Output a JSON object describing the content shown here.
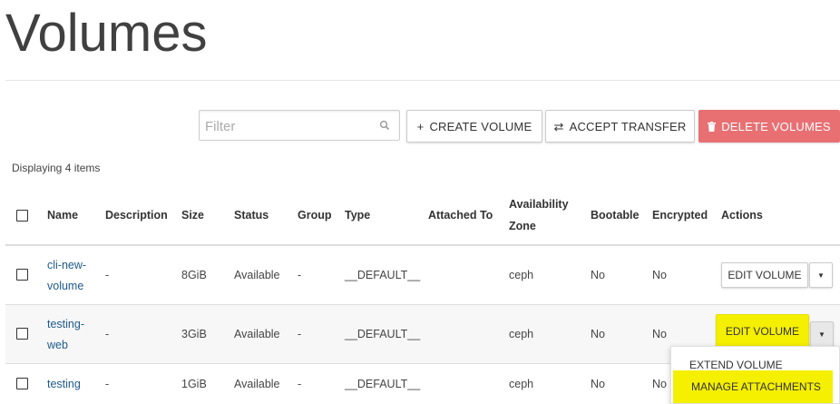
{
  "page": {
    "title": "Volumes"
  },
  "toolbar": {
    "filter_placeholder": "Filter",
    "create_label": "CREATE VOLUME",
    "accept_label": "ACCEPT TRANSFER",
    "delete_label": "DELETE VOLUMES",
    "create_icon": "+",
    "accept_icon": "⇄",
    "delete_icon": "trash-icon"
  },
  "table": {
    "display_count": "Displaying 4 items",
    "headers": {
      "name": "Name",
      "description": "Description",
      "size": "Size",
      "status": "Status",
      "group": "Group",
      "type": "Type",
      "attached_to": "Attached To",
      "availability_zone_line1": "Availability",
      "availability_zone_line2": "Zone",
      "bootable": "Bootable",
      "encrypted": "Encrypted",
      "actions": "Actions"
    },
    "rows": [
      {
        "name_line1": "cli-new-",
        "name_line2": "volume",
        "description": "-",
        "size": "8GiB",
        "status": "Available",
        "group": "-",
        "type": "__DEFAULT__",
        "attached_to": "",
        "zone": "ceph",
        "bootable": "No",
        "encrypted": "No",
        "action_label": "EDIT VOLUME"
      },
      {
        "name_line1": "testing-",
        "name_line2": "web",
        "description": "-",
        "size": "3GiB",
        "status": "Available",
        "group": "-",
        "type": "__DEFAULT__",
        "attached_to": "",
        "zone": "ceph",
        "bootable": "No",
        "encrypted": "No",
        "action_label": "EDIT VOLUME"
      },
      {
        "name_line1": "testing",
        "name_line2": "",
        "description": "-",
        "size": "1GiB",
        "status": "Available",
        "group": "-",
        "type": "__DEFAULT__",
        "attached_to": "",
        "zone": "ceph",
        "bootable": "No",
        "encrypted": "No",
        "action_label": ""
      }
    ]
  },
  "dropdown": {
    "items": [
      "EXTEND VOLUME",
      "MANAGE ATTACHMENTS"
    ]
  },
  "colors": {
    "delete_button": "#e87073",
    "highlight": "#f5ef00",
    "link": "#1f5a8b",
    "alt_row": "#f7f7f7"
  }
}
